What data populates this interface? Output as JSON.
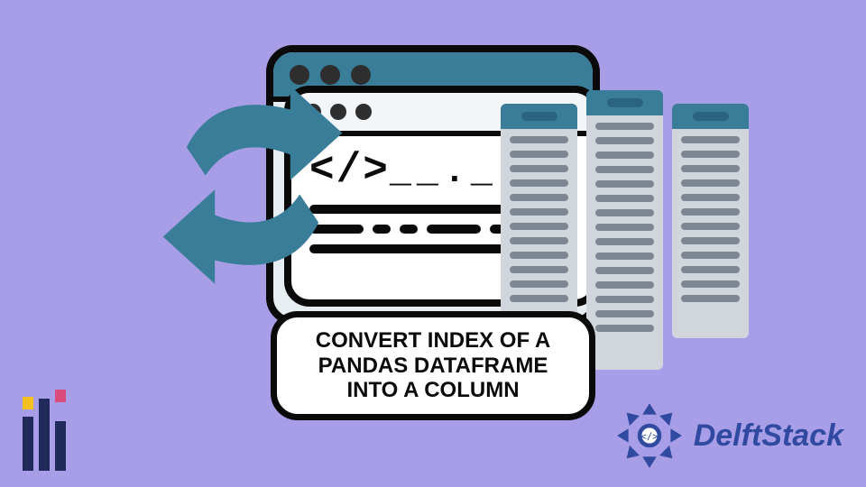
{
  "caption": "CONVERT INDEX OF A PANDAS DATAFRAME INTO A COLUMN",
  "brand": {
    "name": "DelftStack"
  },
  "code_glyphs": {
    "open": "<",
    "slash": "/",
    "close": ">",
    "underscore_dash": "_ _._",
    "dash_pattern": [
      "- -",
      ". .",
      "- -"
    ]
  },
  "colors": {
    "background": "#a89ee8",
    "accent_teal": "#3a7d99",
    "ink": "#0a0a0a",
    "brand_blue": "#2f4aa0"
  },
  "icons": {
    "refresh": "refresh-arrows-icon",
    "code": "code-brackets-icon",
    "table": "data-columns-icon",
    "pandas": "pandas-logo-icon",
    "delftstack_badge": "delftstack-rosette-icon"
  }
}
